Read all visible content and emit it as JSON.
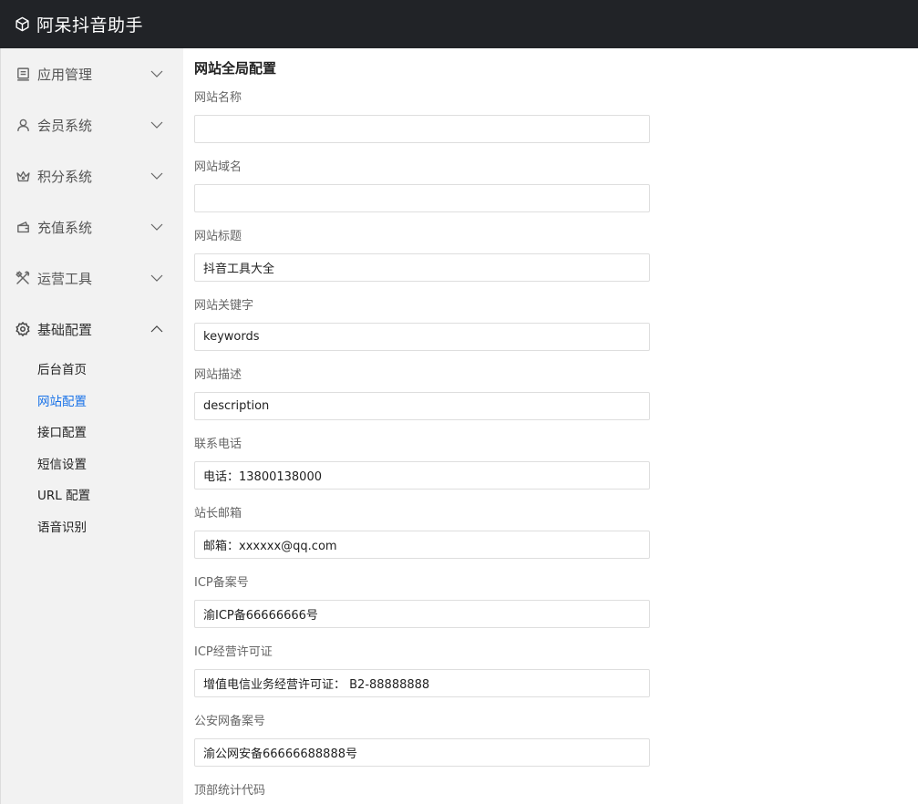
{
  "app": {
    "title": "阿呆抖音助手",
    "logo_icon": "cube-icon"
  },
  "sidebar": {
    "menus": [
      {
        "label": "应用管理",
        "icon": "app-icon",
        "expanded": false
      },
      {
        "label": "会员系统",
        "icon": "user-icon",
        "expanded": false
      },
      {
        "label": "积分系统",
        "icon": "crown-icon",
        "expanded": false
      },
      {
        "label": "充值系统",
        "icon": "wallet-icon",
        "expanded": false
      },
      {
        "label": "运营工具",
        "icon": "tools-icon",
        "expanded": false
      },
      {
        "label": "基础配置",
        "icon": "gear-icon",
        "expanded": true
      }
    ],
    "submenu": [
      {
        "label": "后台首页"
      },
      {
        "label": "网站配置",
        "active": true
      },
      {
        "label": "接口配置"
      },
      {
        "label": "短信设置"
      },
      {
        "label": "URL 配置"
      },
      {
        "label": "语音识别"
      }
    ]
  },
  "main": {
    "title": "网站全局配置",
    "fields": [
      {
        "label": "网站名称",
        "value": ""
      },
      {
        "label": "网站域名",
        "value": ""
      },
      {
        "label": "网站标题",
        "value": "抖音工具大全"
      },
      {
        "label": "网站关键字",
        "value": "keywords"
      },
      {
        "label": "网站描述",
        "value": "description"
      },
      {
        "label": "联系电话",
        "value": "电话：13800138000"
      },
      {
        "label": "站长邮箱",
        "value": "邮箱：xxxxxx@qq.com"
      },
      {
        "label": "ICP备案号",
        "value": "渝ICP备66666666号"
      },
      {
        "label": "ICP经营许可证",
        "value": "增值电信业务经营许可证： B2-88888888"
      },
      {
        "label": "公安网备案号",
        "value": "渝公网安备66666688888号"
      },
      {
        "label": "顶部统计代码",
        "value": ""
      }
    ]
  },
  "colors": {
    "topbar": "#212327",
    "sidebar": "#f2f2f2",
    "active_link": "#1a73e8"
  }
}
